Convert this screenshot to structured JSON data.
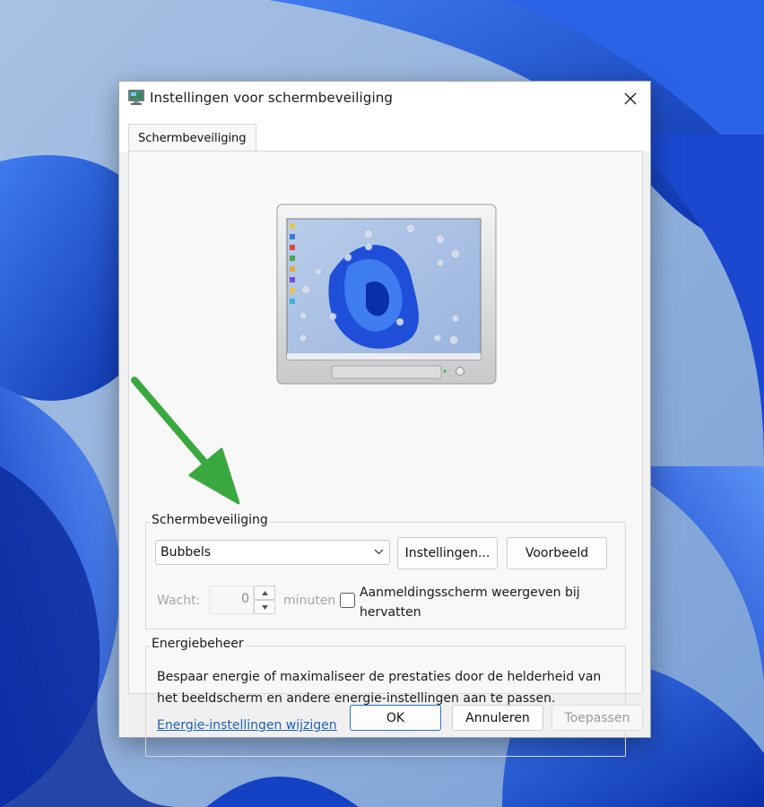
{
  "window": {
    "title": "Instellingen voor schermbeveiliging",
    "close_glyph": "✕"
  },
  "tabs": [
    {
      "label": "Schermbeveiliging",
      "selected": true
    }
  ],
  "screensaver": {
    "group_title": "Schermbeveiliging",
    "selected": "Bubbels",
    "settings_label": "Instellingen...",
    "preview_label": "Voorbeeld",
    "wait_label": "Wacht:",
    "wait_value": "0",
    "minutes_label": "minuten",
    "logon_label": "Aanmeldingsscherm weergeven bij hervatten",
    "logon_checked": false
  },
  "power": {
    "group_title": "Energiebeheer",
    "description": "Bespaar energie of maximaliseer de prestaties door de helderheid van het beeldscherm en andere energie-instellingen aan te passen.",
    "link_label": "Energie-instellingen wijzigen"
  },
  "buttons": {
    "ok": "OK",
    "cancel": "Annuleren",
    "apply": "Toepassen"
  },
  "colors": {
    "accent": "#2a70c8",
    "link": "#1c5fb4",
    "annotation_arrow": "#3aa83f",
    "wallpaper_blue": "#1f4fd8"
  }
}
